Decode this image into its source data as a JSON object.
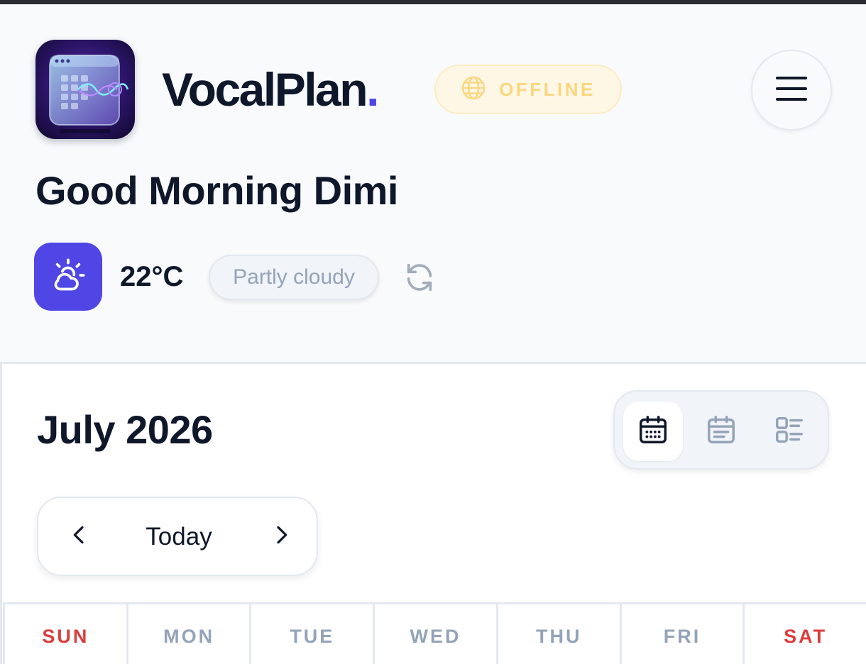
{
  "app": {
    "name": "VocalPlan",
    "name_dot": ".",
    "status": "OFFLINE"
  },
  "greeting": "Good Morning Dimi",
  "weather": {
    "temperature": "22°C",
    "condition": "Partly cloudy"
  },
  "calendar": {
    "month_title": "July 2026",
    "today_label": "Today",
    "weekdays": [
      "SUN",
      "MON",
      "TUE",
      "WED",
      "THU",
      "FRI",
      "SAT"
    ],
    "views": [
      "month-view-icon",
      "week-view-icon",
      "list-view-icon"
    ],
    "active_view": "month-view-icon"
  },
  "colors": {
    "accent": "#4f46e5",
    "text": "#0f172a",
    "muted": "#94a3b8",
    "weekend": "#dc3c3c",
    "offline": "#f9d77e"
  }
}
